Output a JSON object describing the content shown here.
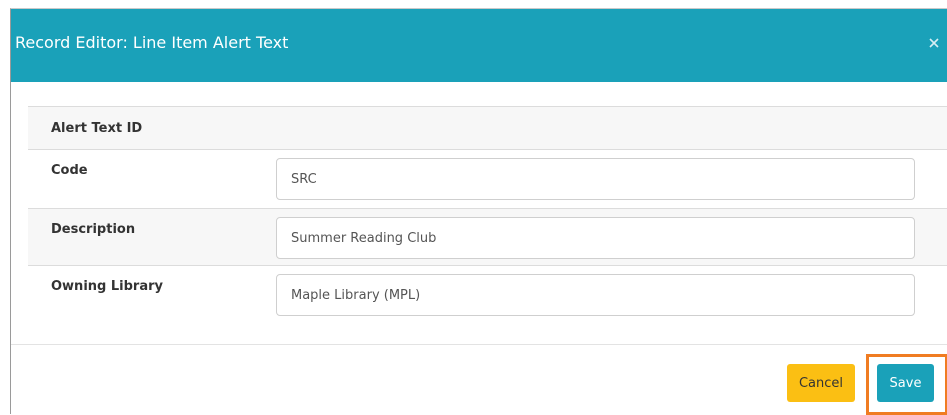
{
  "dialog": {
    "title": "Record Editor: Line Item Alert Text",
    "close_icon": "close-icon"
  },
  "form": {
    "alert_text_id": {
      "label": "Alert Text ID"
    },
    "code": {
      "label": "Code",
      "value": "SRC"
    },
    "description": {
      "label": "Description",
      "value": "Summer Reading Club"
    },
    "owning_library": {
      "label": "Owning Library",
      "value": "Maple Library (MPL)"
    }
  },
  "footer": {
    "cancel_label": "Cancel",
    "save_label": "Save"
  },
  "colors": {
    "header": "#1aa1b9",
    "cancel": "#fbbf13",
    "save": "#1aa1b9",
    "highlight": "#f07c22"
  }
}
